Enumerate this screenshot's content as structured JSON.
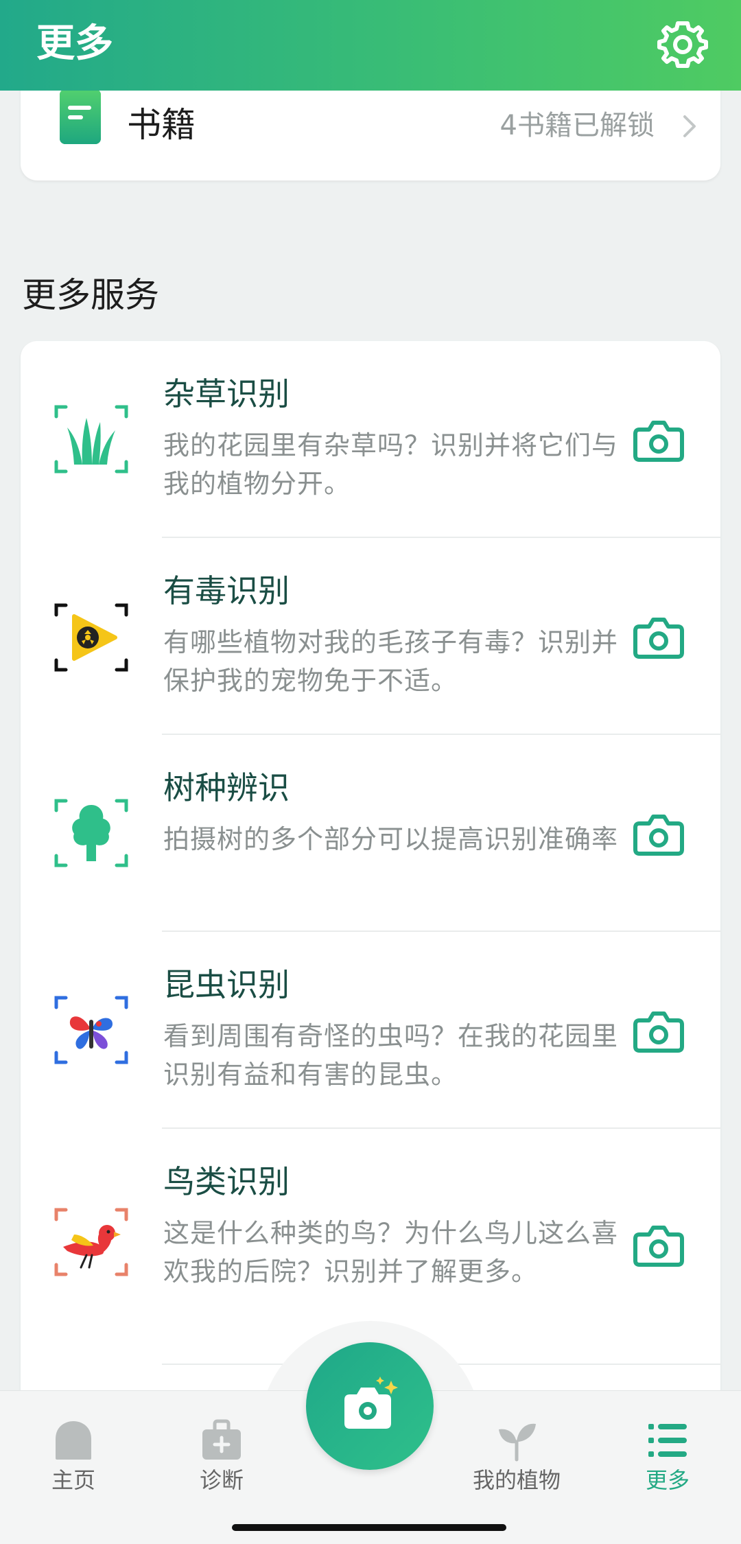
{
  "header": {
    "title": "更多",
    "settings_icon": "gear-icon"
  },
  "books": {
    "label": "书籍",
    "status": "4书籍已解锁",
    "icon": "book-icon"
  },
  "more_services": {
    "section_title": "更多服务",
    "items": [
      {
        "title": "杂草识别",
        "desc": "我的花园里有杂草吗？识别并将它们与我的植物分开。",
        "icon": "weed-scan-icon"
      },
      {
        "title": "有毒识别",
        "desc": "有哪些植物对我的毛孩子有毒？识别并保护我的宠物免于不适。",
        "icon": "toxic-scan-icon"
      },
      {
        "title": "树种辨识",
        "desc": "拍摄树的多个部分可以提高识别准确率",
        "icon": "tree-scan-icon"
      },
      {
        "title": "昆虫识别",
        "desc": "看到周围有奇怪的虫吗？在我的花园里识别有益和有害的昆虫。",
        "icon": "insect-scan-icon"
      },
      {
        "title": "鸟类识别",
        "desc": "这是什么种类的鸟？为什么鸟儿这么喜欢我的后院？识别并了解更多。",
        "icon": "bird-scan-icon"
      }
    ]
  },
  "bottom_nav": {
    "items": [
      {
        "label": "主页",
        "icon": "home-icon",
        "active": false
      },
      {
        "label": "诊断",
        "icon": "medkit-icon",
        "active": false
      },
      {
        "label": "我的植物",
        "icon": "sprout-icon",
        "active": false
      },
      {
        "label": "更多",
        "icon": "list-icon",
        "active": true
      }
    ],
    "camera_button_icon": "camera-sparkle-icon"
  },
  "colors": {
    "accent": "#23a984",
    "header_start": "#22a98a",
    "header_end": "#4fcb62"
  }
}
